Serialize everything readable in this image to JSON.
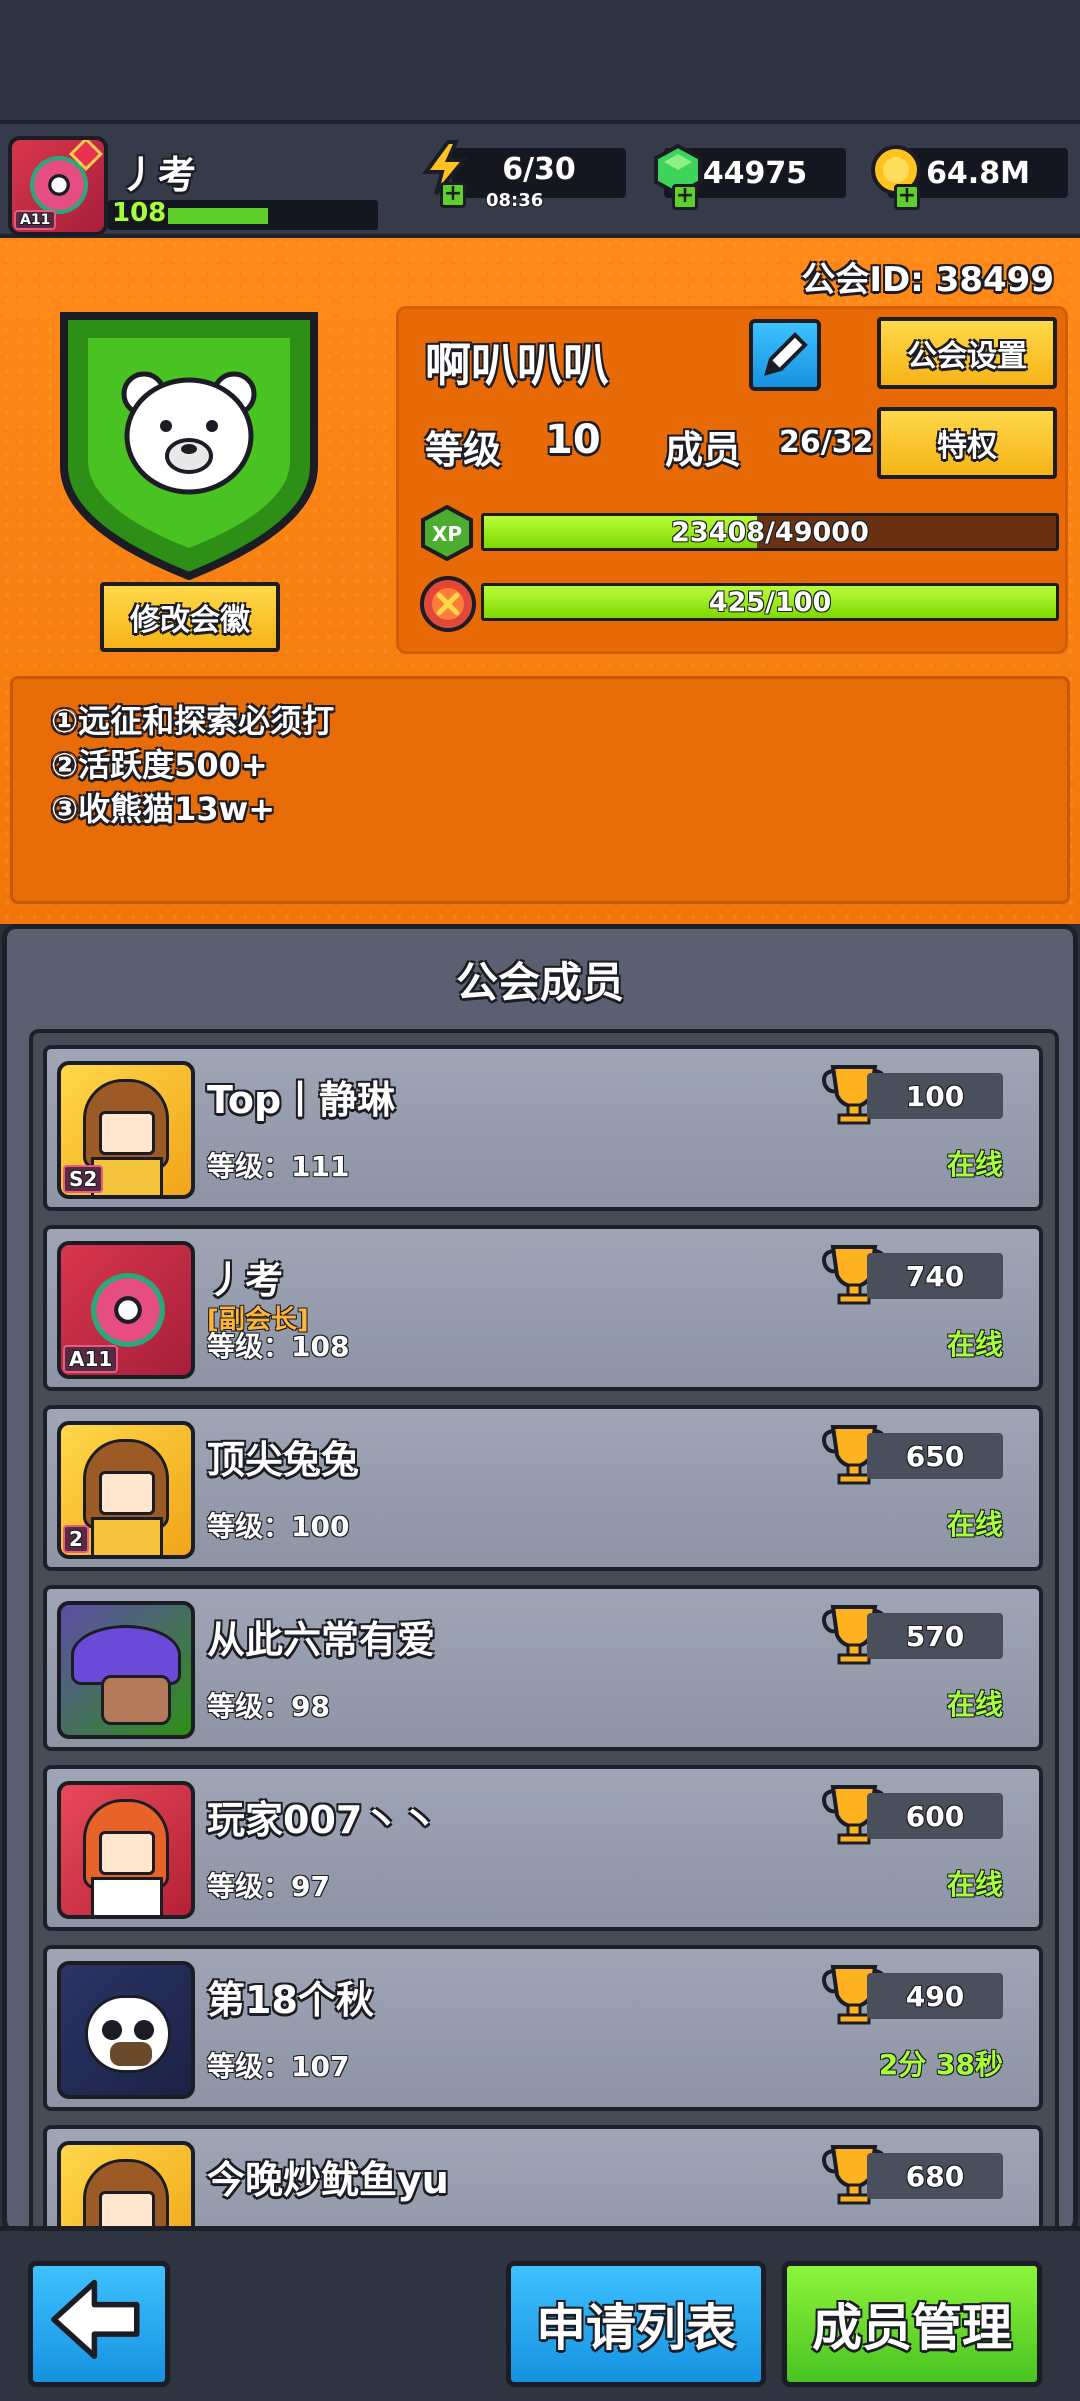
{
  "player": {
    "name": "丿考",
    "level": "108",
    "avatar_badge": "A11",
    "xp_fraction": 0.5
  },
  "resources": {
    "energy": "6/30",
    "energy_timer": "08:36",
    "gems": "44975",
    "coins": "64.8M"
  },
  "guild": {
    "id_text": "公会ID: 38499",
    "name": "啊叭叭叭",
    "settings_label": "公会设置",
    "level_label": "等级",
    "level_value": "10",
    "members_label": "成员",
    "members_value": "26/32",
    "privilege_label": "特权",
    "xp_icon": "XP",
    "xp_text": "23408/49000",
    "xp_fraction": 0.478,
    "activity_text": "425/100",
    "activity_fraction": 1.0,
    "edit_emblem_label": "修改会徽",
    "notice_lines": [
      "①远征和探索必须打",
      "②活跃度500+",
      "③收熊猫13w+"
    ],
    "colors": {
      "accent": "#ff8a1a",
      "bar_fill": "#a8f226",
      "button_yellow": "#ffd84a"
    }
  },
  "members_section": {
    "title": "公会成员",
    "level_prefix": "等级：",
    "members": [
      {
        "name": "Top丨静琳",
        "role": "",
        "level": "111",
        "trophies": "100",
        "status": "在线",
        "avatar_badge": "S2",
        "avatar_style": "girl-gold"
      },
      {
        "name": "丿考",
        "role": "[副会长]",
        "level": "108",
        "trophies": "740",
        "status": "在线",
        "avatar_badge": "A11",
        "avatar_style": "flower-red"
      },
      {
        "name": "顶尖兔兔",
        "role": "",
        "level": "100",
        "trophies": "650",
        "status": "在线",
        "avatar_badge": "2",
        "avatar_style": "girl-gold"
      },
      {
        "name": "从此六常有爱",
        "role": "",
        "level": "98",
        "trophies": "570",
        "status": "在线",
        "avatar_badge": "",
        "avatar_style": "mushroom-green"
      },
      {
        "name": "玩家007丶丶",
        "role": "",
        "level": "97",
        "trophies": "600",
        "status": "在线",
        "avatar_badge": "",
        "avatar_style": "redhair-red"
      },
      {
        "name": "第18个秋",
        "role": "",
        "level": "107",
        "trophies": "490",
        "status": "2分 38秒",
        "avatar_badge": "",
        "avatar_style": "panda-dark"
      },
      {
        "name": "今晚炒鱿鱼yu",
        "role": "",
        "level": "",
        "trophies": "680",
        "status": "",
        "avatar_badge": "",
        "avatar_style": "girl-gold"
      }
    ]
  },
  "bottom": {
    "apply_list_label": "申请列表",
    "member_manage_label": "成员管理"
  }
}
